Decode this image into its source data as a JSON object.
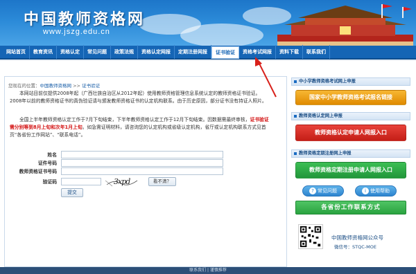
{
  "header": {
    "title": "中国教师资格网",
    "url": "www.jszg.edu.cn"
  },
  "nav": {
    "items": [
      {
        "label": "网站首页"
      },
      {
        "label": "教育资讯"
      },
      {
        "label": "资格认定"
      },
      {
        "label": "常见问题"
      },
      {
        "label": "政策法规"
      },
      {
        "label": "资格认定网报"
      },
      {
        "label": "定期注册网报"
      },
      {
        "label": "证书验证"
      },
      {
        "label": "资格考试网报"
      },
      {
        "label": "资料下载"
      },
      {
        "label": "联系我们"
      }
    ]
  },
  "breadcrumb": {
    "prefix": "您现在的位置：",
    "home": "中国教师资格网",
    "sep": ">>",
    "current": "证书验证"
  },
  "intro": {
    "p1": "本网站目前仅提供2008年起（广西壮族自治区从2012年起）使用教师资格管理信息系统认定的教师资格证书验证。2008年以前的教师资格证书的真伪验证请与颁发教师资格证书的认定机构联系。由于历史原因，部分证书没有持证人照片。",
    "p2_a": "全国上半年教师资格认定工作于7月下旬结束，下半年教师资格认定工作于12月下旬结束。因数据需最终审核，",
    "p2_red": "证书验证需分别等到8月上旬和次年1月上旬",
    "p2_b": "。如急需证明材料，请咨询您的认定机构或省级认定机构，省厅或认定机构联系方式见首页“各省份工作网站”、“联系电话”。"
  },
  "form": {
    "name_label": "姓名",
    "id_label": "证件号码",
    "cert_label": "教师资格证书号码",
    "captcha_label": "验证码",
    "captcha_text": "3xpd",
    "refresh_label": "看不清？",
    "submit_label": "提交"
  },
  "sidebar": {
    "exam_head": "中小学教师资格考试网上申报",
    "exam_btn": "国家中小学教师资格考试报名链接",
    "cert_head": "教师资格认定网上申报",
    "cert_btn": "教师资格认定申请人网报入口",
    "reg_head": "教师资格定期注册网上申报",
    "reg_btn": "教师资格定期注册申请人网报入口",
    "faq_label": "常见问题",
    "help_label": "使用帮助",
    "contact_label": "各省份工作联系方式",
    "wechat_title": "中国教师资格网公众号",
    "wechat_id": "微信号：STQC-MOE"
  },
  "footer": {
    "text": "联系我们 | 谨慎推荐"
  },
  "colors": {
    "nav_bg": "#1565b5",
    "accent_red": "#d20f0f",
    "orange_btn": "#e08a00",
    "red_btn": "#c41e17",
    "green_btn": "#21963a"
  }
}
